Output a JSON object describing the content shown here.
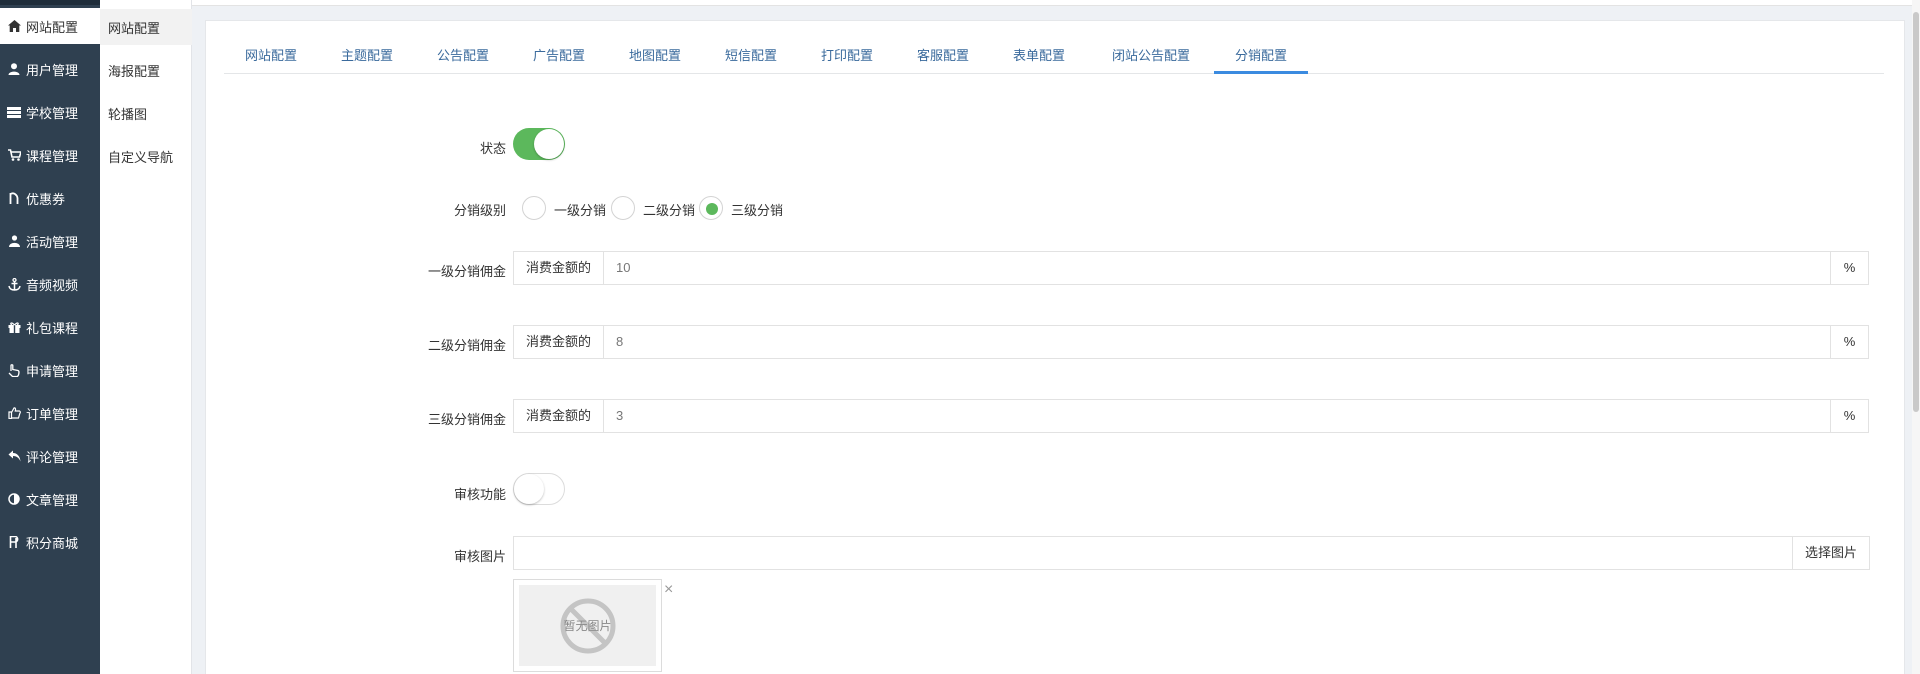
{
  "sidebar": {
    "items": [
      {
        "label": "网站配置",
        "icon": "home-icon"
      },
      {
        "label": "用户管理",
        "icon": "user-icon"
      },
      {
        "label": "学校管理",
        "icon": "school-icon"
      },
      {
        "label": "课程管理",
        "icon": "cart-icon"
      },
      {
        "label": "优惠券",
        "icon": "coupon-icon"
      },
      {
        "label": "活动管理",
        "icon": "group-icon"
      },
      {
        "label": "音频视频",
        "icon": "anchor-icon"
      },
      {
        "label": "礼包课程",
        "icon": "gift-icon"
      },
      {
        "label": "申请管理",
        "icon": "hand-icon"
      },
      {
        "label": "订单管理",
        "icon": "thumb-icon"
      },
      {
        "label": "评论管理",
        "icon": "reply-icon"
      },
      {
        "label": "文章管理",
        "icon": "contrast-icon"
      },
      {
        "label": "积分商城",
        "icon": "points-icon"
      }
    ]
  },
  "subbar": {
    "items": [
      {
        "label": "网站配置"
      },
      {
        "label": "海报配置"
      },
      {
        "label": "轮播图"
      },
      {
        "label": "自定义导航"
      }
    ]
  },
  "tabs": [
    {
      "label": "网站配置"
    },
    {
      "label": "主题配置"
    },
    {
      "label": "公告配置"
    },
    {
      "label": "广告配置"
    },
    {
      "label": "地图配置"
    },
    {
      "label": "短信配置"
    },
    {
      "label": "打印配置"
    },
    {
      "label": "客服配置"
    },
    {
      "label": "表单配置"
    },
    {
      "label": "闭站公告配置"
    },
    {
      "label": "分销配置"
    }
  ],
  "form": {
    "status_label": "状态",
    "status_on": true,
    "level_label": "分销级别",
    "levels": [
      "一级分销",
      "二级分销",
      "三级分销"
    ],
    "level_selected": "三级分销",
    "commission1_label": "一级分销佣金",
    "commission2_label": "二级分销佣金",
    "commission3_label": "三级分销佣金",
    "addon_text": "消费金额的",
    "commission1_value": "10",
    "commission2_value": "8",
    "commission3_value": "3",
    "percent": "%",
    "review_label": "审核功能",
    "review_on": false,
    "review_image_label": "审核图片",
    "review_image_value": "",
    "select_image_button": "选择图片",
    "no_image_text": "暂无图片",
    "remove_symbol": "×"
  },
  "colors": {
    "sidebar_bg": "#2f4050",
    "accent": "#3b8be0",
    "toggle_on": "#5cb85c"
  }
}
